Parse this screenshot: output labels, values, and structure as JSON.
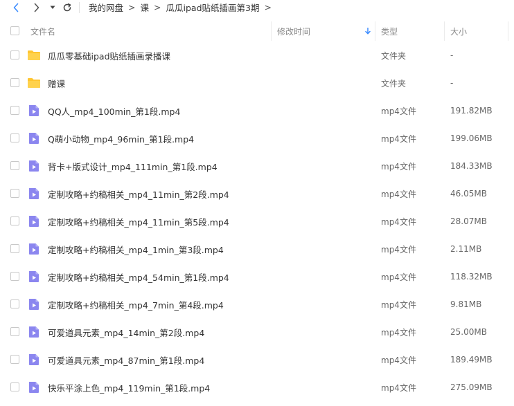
{
  "toolbar": {
    "back_icon": "chevron-left-icon",
    "forward_icon": "chevron-right-icon",
    "history_icon": "caret-down-icon",
    "refresh_icon": "refresh-icon",
    "accent": "#3b8cff"
  },
  "breadcrumb": {
    "items": [
      "我的网盘",
      "课",
      "瓜瓜ipad贴纸插画第3期"
    ],
    "separator": ">"
  },
  "header": {
    "name": "文件名",
    "modified": "修改时间",
    "type": "类型",
    "size": "大小",
    "sort_icon": "arrow-down-icon"
  },
  "colors": {
    "folder": "#ffc530",
    "video": "#8b86ef"
  },
  "files": [
    {
      "name": "瓜瓜零基础ipad贴纸插画录播课",
      "type": "文件夹",
      "size": "-",
      "icon": "folder-icon"
    },
    {
      "name": "赠课",
      "type": "文件夹",
      "size": "-",
      "icon": "folder-icon"
    },
    {
      "name": "QQ人_mp4_100min_第1段.mp4",
      "type": "mp4文件",
      "size": "191.82MB",
      "icon": "video-file-icon"
    },
    {
      "name": "Q萌小动物_mp4_96min_第1段.mp4",
      "type": "mp4文件",
      "size": "199.06MB",
      "icon": "video-file-icon"
    },
    {
      "name": "背卡+版式设计_mp4_111min_第1段.mp4",
      "type": "mp4文件",
      "size": "184.33MB",
      "icon": "video-file-icon"
    },
    {
      "name": "定制攻略+约稿相关_mp4_11min_第2段.mp4",
      "type": "mp4文件",
      "size": "46.05MB",
      "icon": "video-file-icon"
    },
    {
      "name": "定制攻略+约稿相关_mp4_11min_第5段.mp4",
      "type": "mp4文件",
      "size": "28.07MB",
      "icon": "video-file-icon"
    },
    {
      "name": "定制攻略+约稿相关_mp4_1min_第3段.mp4",
      "type": "mp4文件",
      "size": "2.11MB",
      "icon": "video-file-icon"
    },
    {
      "name": "定制攻略+约稿相关_mp4_54min_第1段.mp4",
      "type": "mp4文件",
      "size": "118.32MB",
      "icon": "video-file-icon"
    },
    {
      "name": "定制攻略+约稿相关_mp4_7min_第4段.mp4",
      "type": "mp4文件",
      "size": "9.81MB",
      "icon": "video-file-icon"
    },
    {
      "name": "可爱道具元素_mp4_14min_第2段.mp4",
      "type": "mp4文件",
      "size": "25.00MB",
      "icon": "video-file-icon"
    },
    {
      "name": "可爱道具元素_mp4_87min_第1段.mp4",
      "type": "mp4文件",
      "size": "189.49MB",
      "icon": "video-file-icon"
    },
    {
      "name": "快乐平涂上色_mp4_119min_第1段.mp4",
      "type": "mp4文件",
      "size": "275.09MB",
      "icon": "video-file-icon"
    }
  ]
}
